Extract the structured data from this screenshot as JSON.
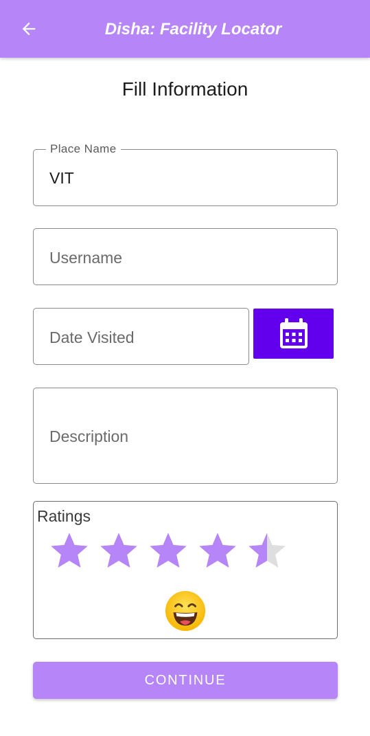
{
  "app_bar": {
    "title": "Disha: Facility Locator",
    "back_icon": "arrow-left-icon",
    "color": "#b685f7"
  },
  "page": {
    "title": "Fill Information"
  },
  "form": {
    "place_name": {
      "label": "Place Name",
      "value": "VIT"
    },
    "username": {
      "placeholder": "Username"
    },
    "date_visited": {
      "placeholder": "Date Visited",
      "calendar_icon": "calendar-icon",
      "button_color": "#6200ee"
    },
    "description": {
      "placeholder": "Description"
    },
    "ratings": {
      "label": "Ratings",
      "value": 4.5,
      "max": 5,
      "star_color": "#b685f7",
      "empty_star_color": "#dedede",
      "emoji": "grinning-face-icon"
    }
  },
  "actions": {
    "continue_label": "CONTINUE"
  }
}
